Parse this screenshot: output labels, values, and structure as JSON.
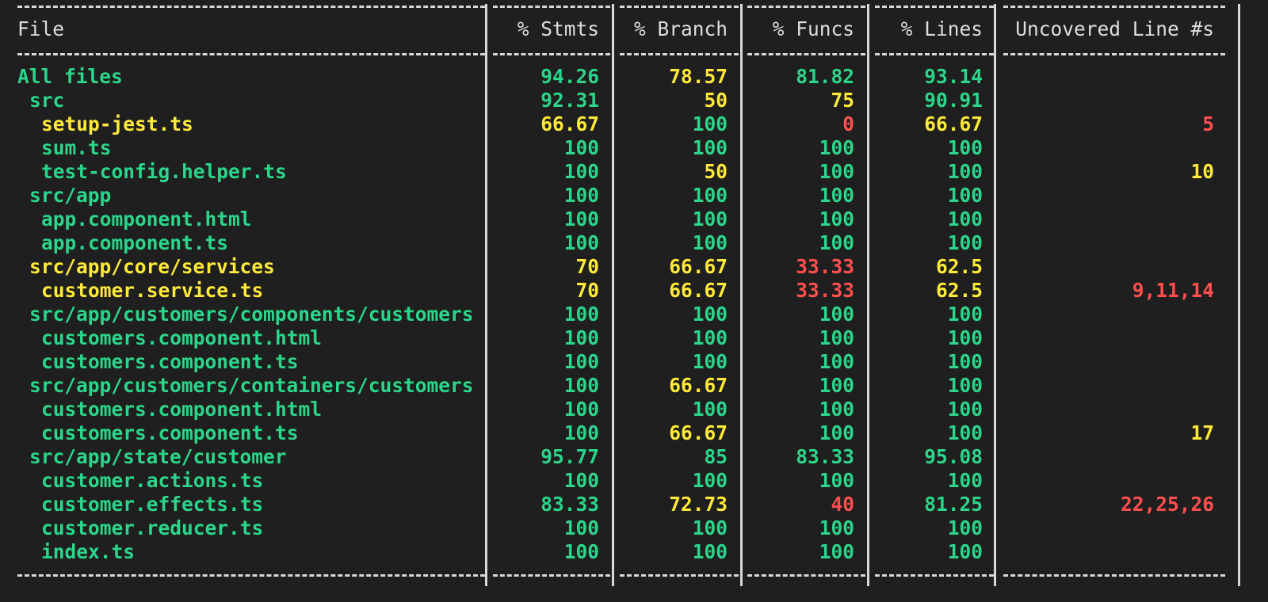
{
  "columns": [
    "File",
    "% Stmts",
    "% Branch",
    "% Funcs",
    "% Lines",
    "Uncovered Line #s"
  ],
  "rows": [
    {
      "file": "All files",
      "indent": 0,
      "stmts": "94.26",
      "branch": "78.57",
      "funcs": "81.82",
      "lines": "93.14",
      "uncovered": "",
      "colors": {
        "file": "green",
        "stmts": "green",
        "branch": "yellow",
        "funcs": "green",
        "lines": "green",
        "uncovered": "green"
      }
    },
    {
      "file": "src",
      "indent": 1,
      "stmts": "92.31",
      "branch": "50",
      "funcs": "75",
      "lines": "90.91",
      "uncovered": "",
      "colors": {
        "file": "green",
        "stmts": "green",
        "branch": "yellow",
        "funcs": "yellow",
        "lines": "green",
        "uncovered": "green"
      }
    },
    {
      "file": "setup-jest.ts",
      "indent": 2,
      "stmts": "66.67",
      "branch": "100",
      "funcs": "0",
      "lines": "66.67",
      "uncovered": "5",
      "colors": {
        "file": "yellow",
        "stmts": "yellow",
        "branch": "green",
        "funcs": "red",
        "lines": "yellow",
        "uncovered": "red"
      }
    },
    {
      "file": "sum.ts",
      "indent": 2,
      "stmts": "100",
      "branch": "100",
      "funcs": "100",
      "lines": "100",
      "uncovered": "",
      "colors": {
        "file": "green",
        "stmts": "green",
        "branch": "green",
        "funcs": "green",
        "lines": "green",
        "uncovered": "green"
      }
    },
    {
      "file": "test-config.helper.ts",
      "indent": 2,
      "stmts": "100",
      "branch": "50",
      "funcs": "100",
      "lines": "100",
      "uncovered": "10",
      "colors": {
        "file": "green",
        "stmts": "green",
        "branch": "yellow",
        "funcs": "green",
        "lines": "green",
        "uncovered": "yellow"
      }
    },
    {
      "file": "src/app",
      "indent": 1,
      "stmts": "100",
      "branch": "100",
      "funcs": "100",
      "lines": "100",
      "uncovered": "",
      "colors": {
        "file": "green",
        "stmts": "green",
        "branch": "green",
        "funcs": "green",
        "lines": "green",
        "uncovered": "green"
      }
    },
    {
      "file": "app.component.html",
      "indent": 2,
      "stmts": "100",
      "branch": "100",
      "funcs": "100",
      "lines": "100",
      "uncovered": "",
      "colors": {
        "file": "green",
        "stmts": "green",
        "branch": "green",
        "funcs": "green",
        "lines": "green",
        "uncovered": "green"
      }
    },
    {
      "file": "app.component.ts",
      "indent": 2,
      "stmts": "100",
      "branch": "100",
      "funcs": "100",
      "lines": "100",
      "uncovered": "",
      "colors": {
        "file": "green",
        "stmts": "green",
        "branch": "green",
        "funcs": "green",
        "lines": "green",
        "uncovered": "green"
      }
    },
    {
      "file": "src/app/core/services",
      "indent": 1,
      "stmts": "70",
      "branch": "66.67",
      "funcs": "33.33",
      "lines": "62.5",
      "uncovered": "",
      "colors": {
        "file": "yellow",
        "stmts": "yellow",
        "branch": "yellow",
        "funcs": "red",
        "lines": "yellow",
        "uncovered": "yellow"
      }
    },
    {
      "file": "customer.service.ts",
      "indent": 2,
      "stmts": "70",
      "branch": "66.67",
      "funcs": "33.33",
      "lines": "62.5",
      "uncovered": "9,11,14",
      "colors": {
        "file": "yellow",
        "stmts": "yellow",
        "branch": "yellow",
        "funcs": "red",
        "lines": "yellow",
        "uncovered": "red"
      }
    },
    {
      "file": "src/app/customers/components/customers",
      "indent": 1,
      "stmts": "100",
      "branch": "100",
      "funcs": "100",
      "lines": "100",
      "uncovered": "",
      "colors": {
        "file": "green",
        "stmts": "green",
        "branch": "green",
        "funcs": "green",
        "lines": "green",
        "uncovered": "green"
      }
    },
    {
      "file": "customers.component.html",
      "indent": 2,
      "stmts": "100",
      "branch": "100",
      "funcs": "100",
      "lines": "100",
      "uncovered": "",
      "colors": {
        "file": "green",
        "stmts": "green",
        "branch": "green",
        "funcs": "green",
        "lines": "green",
        "uncovered": "green"
      }
    },
    {
      "file": "customers.component.ts",
      "indent": 2,
      "stmts": "100",
      "branch": "100",
      "funcs": "100",
      "lines": "100",
      "uncovered": "",
      "colors": {
        "file": "green",
        "stmts": "green",
        "branch": "green",
        "funcs": "green",
        "lines": "green",
        "uncovered": "green"
      }
    },
    {
      "file": "src/app/customers/containers/customers",
      "indent": 1,
      "stmts": "100",
      "branch": "66.67",
      "funcs": "100",
      "lines": "100",
      "uncovered": "",
      "colors": {
        "file": "green",
        "stmts": "green",
        "branch": "yellow",
        "funcs": "green",
        "lines": "green",
        "uncovered": "green"
      }
    },
    {
      "file": "customers.component.html",
      "indent": 2,
      "stmts": "100",
      "branch": "100",
      "funcs": "100",
      "lines": "100",
      "uncovered": "",
      "colors": {
        "file": "green",
        "stmts": "green",
        "branch": "green",
        "funcs": "green",
        "lines": "green",
        "uncovered": "green"
      }
    },
    {
      "file": "customers.component.ts",
      "indent": 2,
      "stmts": "100",
      "branch": "66.67",
      "funcs": "100",
      "lines": "100",
      "uncovered": "17",
      "colors": {
        "file": "green",
        "stmts": "green",
        "branch": "yellow",
        "funcs": "green",
        "lines": "green",
        "uncovered": "yellow"
      }
    },
    {
      "file": "src/app/state/customer",
      "indent": 1,
      "stmts": "95.77",
      "branch": "85",
      "funcs": "83.33",
      "lines": "95.08",
      "uncovered": "",
      "colors": {
        "file": "green",
        "stmts": "green",
        "branch": "green",
        "funcs": "green",
        "lines": "green",
        "uncovered": "green"
      }
    },
    {
      "file": "customer.actions.ts",
      "indent": 2,
      "stmts": "100",
      "branch": "100",
      "funcs": "100",
      "lines": "100",
      "uncovered": "",
      "colors": {
        "file": "green",
        "stmts": "green",
        "branch": "green",
        "funcs": "green",
        "lines": "green",
        "uncovered": "green"
      }
    },
    {
      "file": "customer.effects.ts",
      "indent": 2,
      "stmts": "83.33",
      "branch": "72.73",
      "funcs": "40",
      "lines": "81.25",
      "uncovered": "22,25,26",
      "colors": {
        "file": "green",
        "stmts": "green",
        "branch": "yellow",
        "funcs": "red",
        "lines": "green",
        "uncovered": "red"
      }
    },
    {
      "file": "customer.reducer.ts",
      "indent": 2,
      "stmts": "100",
      "branch": "100",
      "funcs": "100",
      "lines": "100",
      "uncovered": "",
      "colors": {
        "file": "green",
        "stmts": "green",
        "branch": "green",
        "funcs": "green",
        "lines": "green",
        "uncovered": "green"
      }
    },
    {
      "file": "index.ts",
      "indent": 2,
      "stmts": "100",
      "branch": "100",
      "funcs": "100",
      "lines": "100",
      "uncovered": "",
      "colors": {
        "file": "green",
        "stmts": "green",
        "branch": "green",
        "funcs": "green",
        "lines": "green",
        "uncovered": "green"
      }
    }
  ],
  "theme": {
    "background": "#1f1f1f",
    "border": "#d8d8d8",
    "text": "#dedede",
    "green": "#2bd68a",
    "yellow": "#ffea3a",
    "red": "#ff4f4f"
  }
}
